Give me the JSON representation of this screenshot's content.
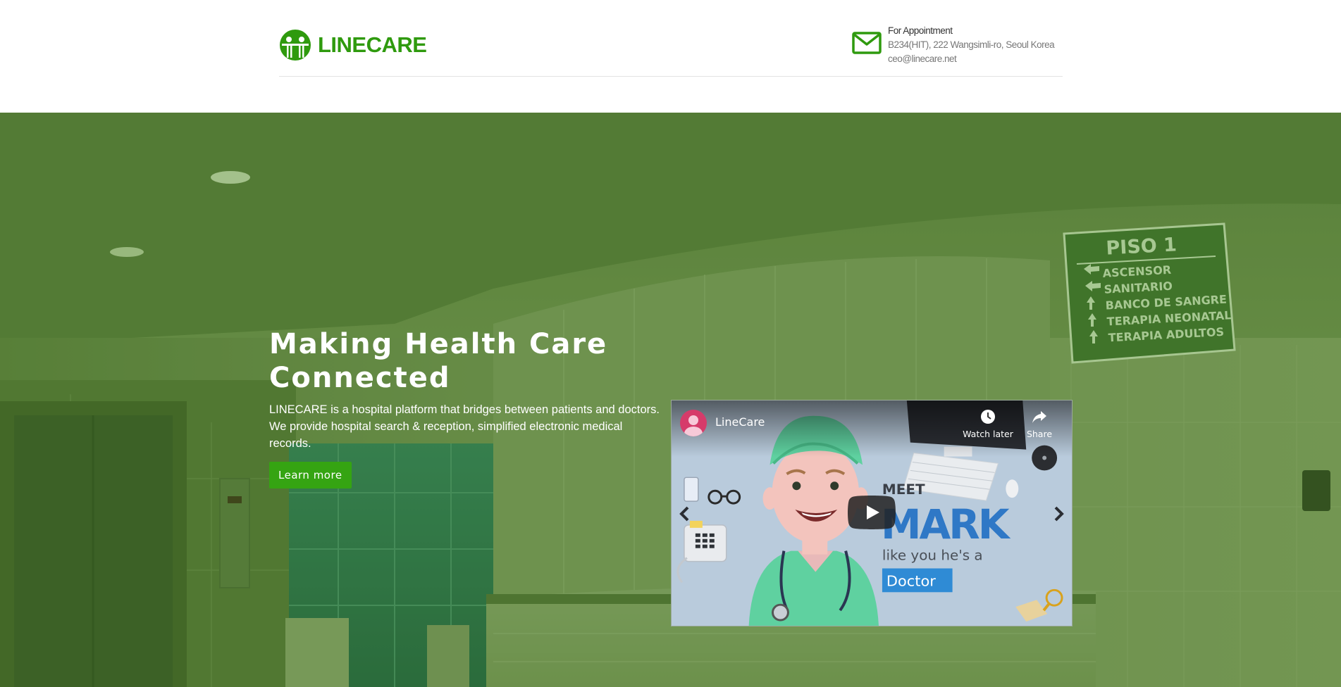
{
  "header": {
    "brand": "LINECARE",
    "contact": {
      "title": "For Appointment",
      "address": "B234(HIT), 222 Wangsimli-ro, Seoul Korea",
      "email": "ceo@linecare.net"
    }
  },
  "hero": {
    "title_line1": "Making Health Care",
    "title_line2": "Connected",
    "description": "LINECARE is a hospital platform that bridges between patients and doctors. We provide hospital search & reception, simplified electronic medical records.",
    "cta_label": "Learn more"
  },
  "video": {
    "channel": "LineCare",
    "watch_later": "Watch later",
    "share": "Share",
    "thumbnail": {
      "meet": "MEET",
      "name": "MARK",
      "tagline": "like you he's a",
      "role": "Doctor"
    }
  },
  "background_sign": {
    "title": "PISO 1",
    "lines": [
      "ASCENSOR",
      "SANITARIO",
      "BANCO DE SANGRE",
      "TERAPIA NEONATAL",
      "TERAPIA ADULTOS"
    ]
  },
  "colors": {
    "brand_green": "#2f9a0e",
    "button_green": "#35a412",
    "hero_tint": "#4d8c1e"
  },
  "icons": [
    "linecare-logo-icon",
    "envelope-icon",
    "clock-icon",
    "share-icon",
    "play-icon",
    "chevron-left-icon",
    "chevron-right-icon"
  ]
}
